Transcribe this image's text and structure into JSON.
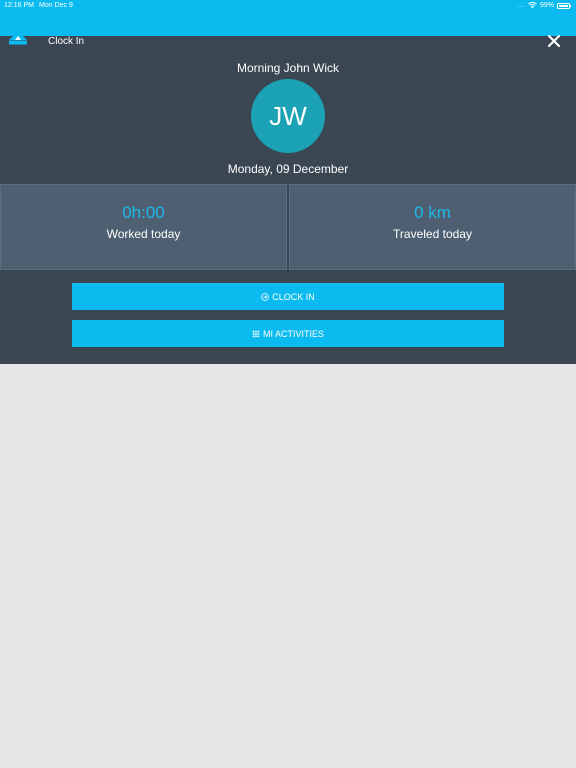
{
  "status_bar": {
    "time": "12:16 PM",
    "date": "Mon Dec 9",
    "signal": "....",
    "battery": "99%"
  },
  "header": {
    "title": "Clock In"
  },
  "profile": {
    "greeting": "Morning John Wick",
    "initials": "JW",
    "date": "Monday, 09 December"
  },
  "stats": [
    {
      "value": "0h:00",
      "label": "Worked today"
    },
    {
      "value": "0 km",
      "label": "Traveled today"
    }
  ],
  "actions": {
    "clock_in": "CLOCK IN",
    "activities": "MI ACTIVITIES"
  },
  "colors": {
    "accent": "#0bbbef",
    "panel": "#3b4653",
    "avatar": "#1ba3b5",
    "background": "#e5e5e5"
  }
}
